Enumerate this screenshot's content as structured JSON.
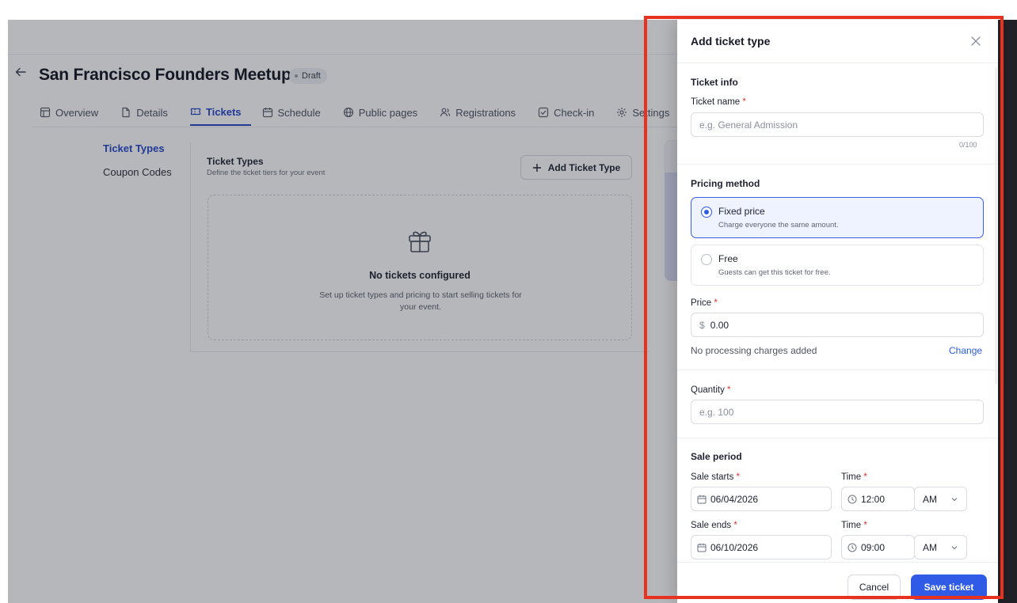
{
  "app": {
    "event_title": "San Francisco Founders Meetup",
    "status_badge": "Draft",
    "tabs": [
      {
        "label": "Overview",
        "icon": "layout-icon",
        "active": false
      },
      {
        "label": "Details",
        "icon": "file-icon",
        "active": false
      },
      {
        "label": "Tickets",
        "icon": "ticket-icon",
        "active": true
      },
      {
        "label": "Schedule",
        "icon": "calendar-icon",
        "active": false
      },
      {
        "label": "Public pages",
        "icon": "globe-icon",
        "active": false
      },
      {
        "label": "Registrations",
        "icon": "users-icon",
        "active": false
      },
      {
        "label": "Check-in",
        "icon": "check-square-icon",
        "active": false
      },
      {
        "label": "Settings",
        "icon": "gear-icon",
        "active": false
      }
    ],
    "subnav": [
      {
        "label": "Ticket Types",
        "active": true
      },
      {
        "label": "Coupon Codes",
        "active": false
      }
    ],
    "panel": {
      "title": "Ticket Types",
      "subtitle": "Define the ticket tiers for your event",
      "add_button": "Add Ticket Type",
      "empty_title": "No tickets configured",
      "empty_text": "Set up ticket types and pricing to start selling tickets for your event."
    }
  },
  "drawer": {
    "title": "Add ticket type",
    "ticket_info": {
      "section_title": "Ticket info",
      "name_label": "Ticket name",
      "name_placeholder": "e.g. General Admission",
      "char_counter": "0/100"
    },
    "pricing": {
      "section_title": "Pricing method",
      "options": [
        {
          "title": "Fixed price",
          "desc": "Charge everyone the same amount.",
          "selected": true
        },
        {
          "title": "Free",
          "desc": "Guests can get this ticket for free.",
          "selected": false
        }
      ],
      "price_label": "Price",
      "currency_symbol": "$",
      "price_value": "0.00",
      "processing_note": "No processing charges added",
      "change_link": "Change"
    },
    "quantity": {
      "label": "Quantity",
      "placeholder": "e.g. 100"
    },
    "sale_period": {
      "section_title": "Sale period",
      "starts_label": "Sale starts",
      "starts_date": "06/04/2026",
      "starts_time_label": "Time",
      "starts_time": "12:00",
      "starts_ampm": "AM",
      "ends_label": "Sale ends",
      "ends_date": "06/10/2026",
      "ends_time_label": "Time",
      "ends_time": "09:00",
      "ends_ampm": "AM"
    },
    "required_mark": "*",
    "footer": {
      "cancel": "Cancel",
      "save": "Save ticket"
    }
  },
  "colors": {
    "accent": "#2f5be6",
    "highlight_border": "#e8311f",
    "required": "#e0352f"
  }
}
